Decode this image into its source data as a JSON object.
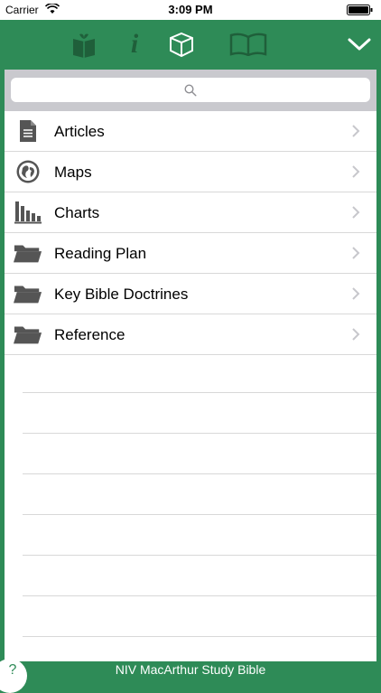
{
  "status_bar": {
    "carrier": "Carrier",
    "time": "3:09 PM"
  },
  "toolbar": {
    "icons": [
      "gift-book-icon",
      "info-icon",
      "box-icon",
      "open-book-icon",
      "chevron-down-icon"
    ],
    "info_glyph": "i"
  },
  "search": {
    "placeholder": ""
  },
  "list": {
    "items": [
      {
        "label": "Articles",
        "icon": "document-icon"
      },
      {
        "label": "Maps",
        "icon": "globe-icon"
      },
      {
        "label": "Charts",
        "icon": "bar-chart-icon"
      },
      {
        "label": "Reading Plan",
        "icon": "folder-icon"
      },
      {
        "label": "Key Bible Doctrines",
        "icon": "folder-icon"
      },
      {
        "label": "Reference",
        "icon": "folder-icon"
      }
    ]
  },
  "footer": {
    "title": "NIV MacArthur Study Bible",
    "help_label": "?"
  },
  "colors": {
    "brand_green": "#2e8b57",
    "dark_green": "#1f5f3a",
    "icon_gray": "#555555"
  }
}
